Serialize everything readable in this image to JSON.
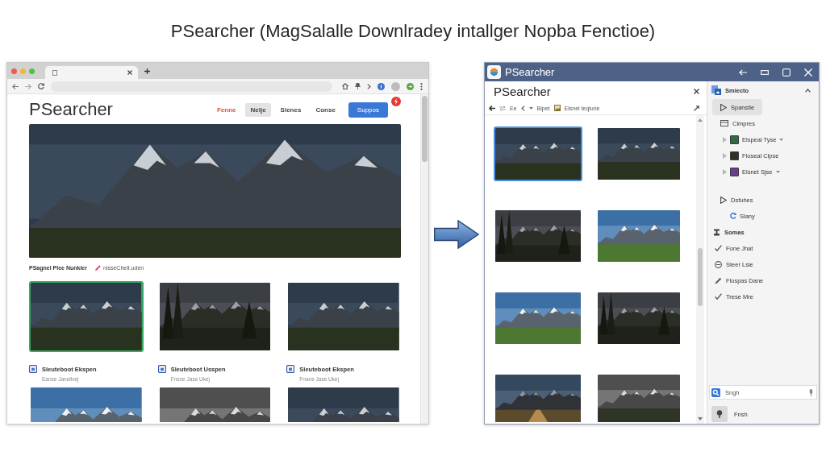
{
  "title": "PSearcher (MagSalalle Downlradey intallger Nopba Fenctioe)",
  "browser": {
    "page": {
      "logo": "PSearcher",
      "nav": [
        {
          "label": "Fenne",
          "kind": "accent",
          "selected": false
        },
        {
          "label": "Nelje",
          "kind": "link",
          "selected": true
        },
        {
          "label": "Slenes",
          "kind": "link",
          "selected": false
        },
        {
          "label": "Conse",
          "kind": "link",
          "selected": false
        },
        {
          "label": "Suppos",
          "kind": "primary",
          "selected": false
        }
      ],
      "hero": {
        "kind": "dusk"
      },
      "section": {
        "heading": "PSagnel Plee Nunkler",
        "link": "nisseChelt.uden"
      },
      "photos_top": [
        {
          "kind": "dusk",
          "selected": true
        },
        {
          "kind": "forest",
          "selected": false
        },
        {
          "kind": "dusk",
          "selected": false
        }
      ],
      "captions": [
        {
          "title": "Sleuteboot Ekspen",
          "subtitle": "Eanse Janeilvej"
        },
        {
          "title": "Sleuteboot Usspen",
          "subtitle": "Fnsne Jase Ukej"
        },
        {
          "title": "Sleuteboot Ekspen",
          "subtitle": "Fnane Jase Ukej"
        }
      ],
      "photos_bottom": [
        {
          "kind": "day",
          "selected": false
        },
        {
          "kind": "gray",
          "selected": false
        },
        {
          "kind": "dusk",
          "selected": false
        }
      ]
    }
  },
  "app": {
    "title": "PSearcher",
    "pane": {
      "title": "PSearcher",
      "toolbar": [
        "Ee",
        "Bipet",
        "Elsnel teqlune"
      ],
      "photos": [
        {
          "kind": "dusk",
          "selected": true
        },
        {
          "kind": "dusk",
          "selected": false
        },
        {
          "kind": "forest",
          "selected": false
        },
        {
          "kind": "day",
          "selected": false
        },
        {
          "kind": "day",
          "selected": false
        },
        {
          "kind": "forest",
          "selected": false
        },
        {
          "kind": "road",
          "selected": false
        },
        {
          "kind": "gray",
          "selected": false
        }
      ]
    },
    "sidebar": {
      "title": "Smiecto",
      "groups": [
        {
          "items": [
            {
              "label": "Spanstie",
              "selected": true
            },
            {
              "label": "Cimpres",
              "selected": false,
              "children": [
                {
                  "label": "Elspeal Tyse",
                  "selected": false,
                  "expanded": false,
                  "color": "#2f6b43",
                  "caret": true
                },
                {
                  "label": "Floseal Clpse",
                  "selected": false,
                  "expanded": false,
                  "color": "#2b3526",
                  "caret": false
                },
                {
                  "label": "Elsnet Sjse",
                  "selected": false,
                  "expanded": false,
                  "color": "#6a3d8e",
                  "caret": true
                }
              ]
            }
          ]
        },
        {
          "items": [
            {
              "label": "Dsfuhes",
              "selected": false,
              "children": [
                {
                  "label": "Slany",
                  "selected": false
                }
              ]
            }
          ]
        }
      ],
      "section": {
        "title": "Somas",
        "items": [
          {
            "label": "Fone Jhat",
            "selected": false
          },
          {
            "label": "Steer Lsie",
            "selected": false
          },
          {
            "label": "Flospas Dane",
            "selected": false
          },
          {
            "label": "Trese Mre",
            "selected": false
          }
        ]
      },
      "search": {
        "placeholder": "Sngh"
      },
      "button": "Fnsh"
    }
  }
}
